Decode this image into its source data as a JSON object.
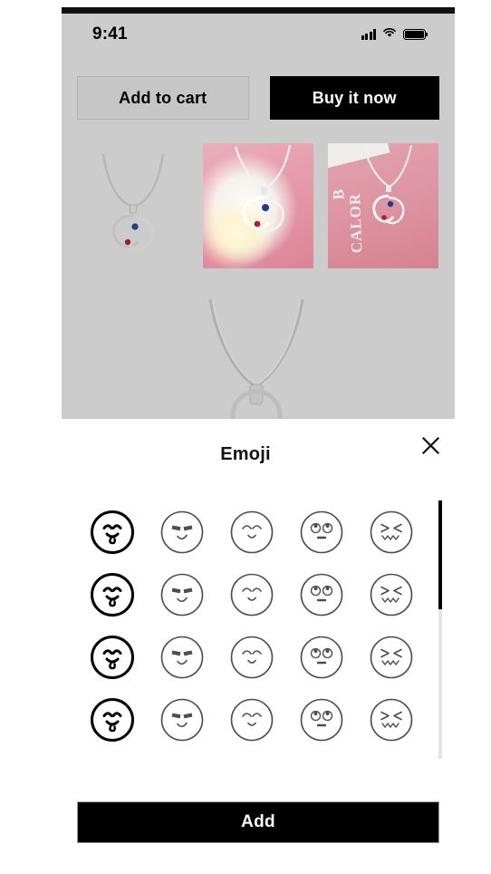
{
  "status_bar": {
    "time": "9:41",
    "signal_icon": "cellular-signal-icon",
    "wifi_icon": "wifi-icon",
    "battery_icon": "battery-full-icon"
  },
  "product_page": {
    "add_to_cart_label": "Add to cart",
    "buy_now_label": "Buy it now",
    "thumbnails": [
      {
        "alt": "Silver double heart necklace on gray background",
        "style": "plain"
      },
      {
        "alt": "Silver double heart necklace on white flower with pink background",
        "style": "flower"
      },
      {
        "alt": "Silver double heart necklace on pink card",
        "style": "pinkcard",
        "card_text_1": "B",
        "card_text_2": "CALOR"
      }
    ],
    "hero_alt": "Silver chain necklace with heart pendant"
  },
  "emoji_modal": {
    "title": "Emoji",
    "close_icon": "close-icon",
    "add_label": "Add",
    "scrollbar": {
      "thumb_percent": 42
    },
    "columns": 5,
    "rows": 4,
    "emoji_types": [
      {
        "id": "savoring-face",
        "name": "face-savoring-food",
        "selected": true,
        "stroke": "#000000",
        "stroke_width": 3
      },
      {
        "id": "smug-face",
        "name": "smirking-face",
        "selected": false,
        "stroke": "#4d4d4d",
        "stroke_width": 1.6
      },
      {
        "id": "smiling-face",
        "name": "smiling-face-with-smiling-eyes",
        "selected": false,
        "stroke": "#4d4d4d",
        "stroke_width": 1.6
      },
      {
        "id": "rolling-eyes-face",
        "name": "face-with-rolling-eyes",
        "selected": false,
        "stroke": "#4d4d4d",
        "stroke_width": 1.6
      },
      {
        "id": "confounded-face",
        "name": "confounded-face",
        "selected": false,
        "stroke": "#4d4d4d",
        "stroke_width": 1.6
      }
    ],
    "grid": [
      [
        "savoring-face",
        "smug-face",
        "smiling-face",
        "rolling-eyes-face",
        "confounded-face"
      ],
      [
        "savoring-face",
        "smug-face",
        "smiling-face",
        "rolling-eyes-face",
        "confounded-face"
      ],
      [
        "savoring-face",
        "smug-face",
        "smiling-face",
        "rolling-eyes-face",
        "confounded-face"
      ],
      [
        "savoring-face",
        "smug-face",
        "smiling-face",
        "rolling-eyes-face",
        "confounded-face"
      ]
    ]
  },
  "colors": {
    "sheet_bg": "#ffffff",
    "page_bg": "#cccccc",
    "accent_black": "#000000",
    "cta_secondary": "#c6c6c6",
    "scrollbar_track": "#e4e4e4"
  }
}
